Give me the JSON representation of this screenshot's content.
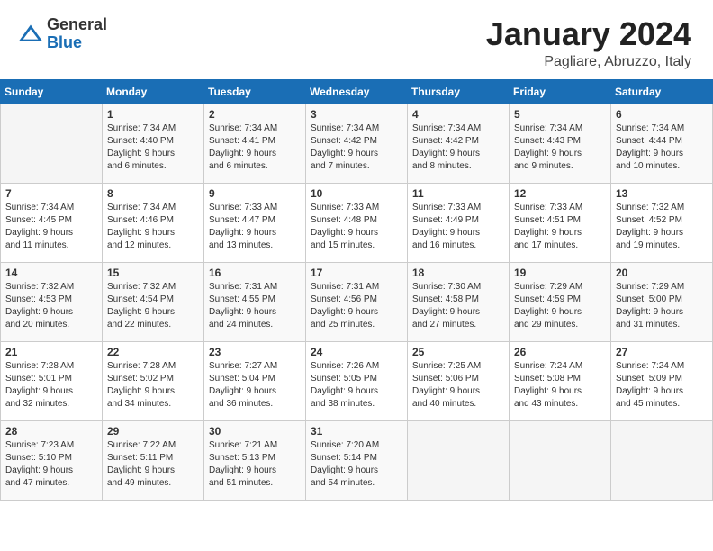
{
  "header": {
    "logo_general": "General",
    "logo_blue": "Blue",
    "month_title": "January 2024",
    "location": "Pagliare, Abruzzo, Italy"
  },
  "weekdays": [
    "Sunday",
    "Monday",
    "Tuesday",
    "Wednesday",
    "Thursday",
    "Friday",
    "Saturday"
  ],
  "weeks": [
    [
      {
        "day": "",
        "info": ""
      },
      {
        "day": "1",
        "info": "Sunrise: 7:34 AM\nSunset: 4:40 PM\nDaylight: 9 hours\nand 6 minutes."
      },
      {
        "day": "2",
        "info": "Sunrise: 7:34 AM\nSunset: 4:41 PM\nDaylight: 9 hours\nand 6 minutes."
      },
      {
        "day": "3",
        "info": "Sunrise: 7:34 AM\nSunset: 4:42 PM\nDaylight: 9 hours\nand 7 minutes."
      },
      {
        "day": "4",
        "info": "Sunrise: 7:34 AM\nSunset: 4:42 PM\nDaylight: 9 hours\nand 8 minutes."
      },
      {
        "day": "5",
        "info": "Sunrise: 7:34 AM\nSunset: 4:43 PM\nDaylight: 9 hours\nand 9 minutes."
      },
      {
        "day": "6",
        "info": "Sunrise: 7:34 AM\nSunset: 4:44 PM\nDaylight: 9 hours\nand 10 minutes."
      }
    ],
    [
      {
        "day": "7",
        "info": "Sunrise: 7:34 AM\nSunset: 4:45 PM\nDaylight: 9 hours\nand 11 minutes."
      },
      {
        "day": "8",
        "info": "Sunrise: 7:34 AM\nSunset: 4:46 PM\nDaylight: 9 hours\nand 12 minutes."
      },
      {
        "day": "9",
        "info": "Sunrise: 7:33 AM\nSunset: 4:47 PM\nDaylight: 9 hours\nand 13 minutes."
      },
      {
        "day": "10",
        "info": "Sunrise: 7:33 AM\nSunset: 4:48 PM\nDaylight: 9 hours\nand 15 minutes."
      },
      {
        "day": "11",
        "info": "Sunrise: 7:33 AM\nSunset: 4:49 PM\nDaylight: 9 hours\nand 16 minutes."
      },
      {
        "day": "12",
        "info": "Sunrise: 7:33 AM\nSunset: 4:51 PM\nDaylight: 9 hours\nand 17 minutes."
      },
      {
        "day": "13",
        "info": "Sunrise: 7:32 AM\nSunset: 4:52 PM\nDaylight: 9 hours\nand 19 minutes."
      }
    ],
    [
      {
        "day": "14",
        "info": "Sunrise: 7:32 AM\nSunset: 4:53 PM\nDaylight: 9 hours\nand 20 minutes."
      },
      {
        "day": "15",
        "info": "Sunrise: 7:32 AM\nSunset: 4:54 PM\nDaylight: 9 hours\nand 22 minutes."
      },
      {
        "day": "16",
        "info": "Sunrise: 7:31 AM\nSunset: 4:55 PM\nDaylight: 9 hours\nand 24 minutes."
      },
      {
        "day": "17",
        "info": "Sunrise: 7:31 AM\nSunset: 4:56 PM\nDaylight: 9 hours\nand 25 minutes."
      },
      {
        "day": "18",
        "info": "Sunrise: 7:30 AM\nSunset: 4:58 PM\nDaylight: 9 hours\nand 27 minutes."
      },
      {
        "day": "19",
        "info": "Sunrise: 7:29 AM\nSunset: 4:59 PM\nDaylight: 9 hours\nand 29 minutes."
      },
      {
        "day": "20",
        "info": "Sunrise: 7:29 AM\nSunset: 5:00 PM\nDaylight: 9 hours\nand 31 minutes."
      }
    ],
    [
      {
        "day": "21",
        "info": "Sunrise: 7:28 AM\nSunset: 5:01 PM\nDaylight: 9 hours\nand 32 minutes."
      },
      {
        "day": "22",
        "info": "Sunrise: 7:28 AM\nSunset: 5:02 PM\nDaylight: 9 hours\nand 34 minutes."
      },
      {
        "day": "23",
        "info": "Sunrise: 7:27 AM\nSunset: 5:04 PM\nDaylight: 9 hours\nand 36 minutes."
      },
      {
        "day": "24",
        "info": "Sunrise: 7:26 AM\nSunset: 5:05 PM\nDaylight: 9 hours\nand 38 minutes."
      },
      {
        "day": "25",
        "info": "Sunrise: 7:25 AM\nSunset: 5:06 PM\nDaylight: 9 hours\nand 40 minutes."
      },
      {
        "day": "26",
        "info": "Sunrise: 7:24 AM\nSunset: 5:08 PM\nDaylight: 9 hours\nand 43 minutes."
      },
      {
        "day": "27",
        "info": "Sunrise: 7:24 AM\nSunset: 5:09 PM\nDaylight: 9 hours\nand 45 minutes."
      }
    ],
    [
      {
        "day": "28",
        "info": "Sunrise: 7:23 AM\nSunset: 5:10 PM\nDaylight: 9 hours\nand 47 minutes."
      },
      {
        "day": "29",
        "info": "Sunrise: 7:22 AM\nSunset: 5:11 PM\nDaylight: 9 hours\nand 49 minutes."
      },
      {
        "day": "30",
        "info": "Sunrise: 7:21 AM\nSunset: 5:13 PM\nDaylight: 9 hours\nand 51 minutes."
      },
      {
        "day": "31",
        "info": "Sunrise: 7:20 AM\nSunset: 5:14 PM\nDaylight: 9 hours\nand 54 minutes."
      },
      {
        "day": "",
        "info": ""
      },
      {
        "day": "",
        "info": ""
      },
      {
        "day": "",
        "info": ""
      }
    ]
  ]
}
